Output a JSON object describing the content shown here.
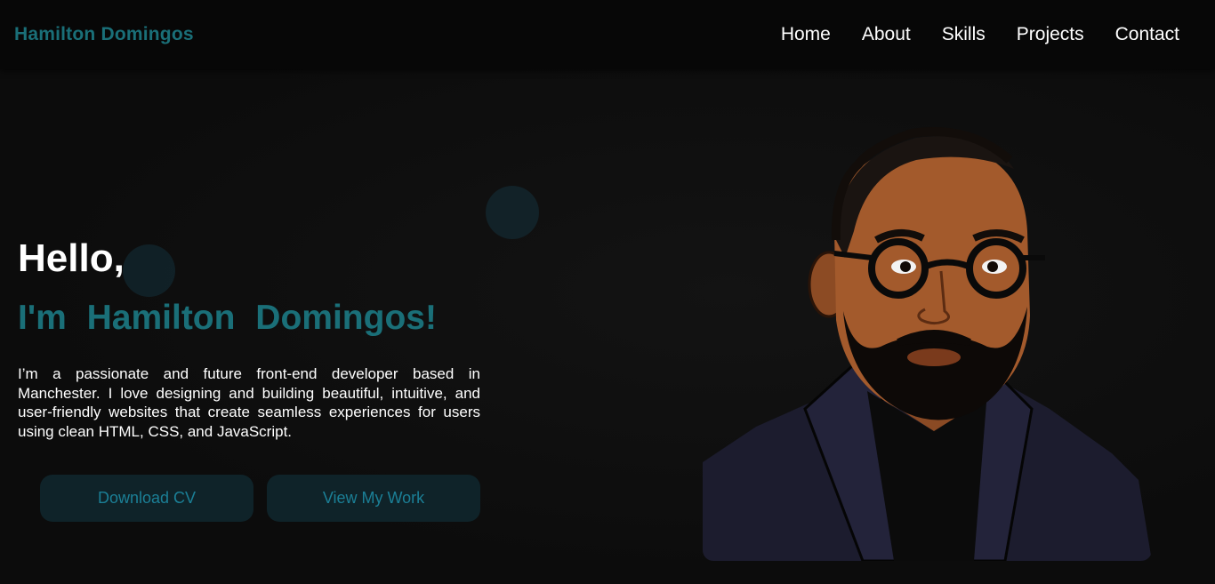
{
  "navbar": {
    "brand": "Hamilton Domingos",
    "links": [
      "Home",
      "About",
      "Skills",
      "Projects",
      "Contact"
    ]
  },
  "hero": {
    "greeting": "Hello,",
    "name_line": "I'm Hamilton Domingos!",
    "intro": "I’m a passionate and future front-end developer based in Manchester. I love designing and building beautiful, intuitive, and user-friendly websites that create seamless experiences for users using clean HTML, CSS, and JavaScript.",
    "buttons": {
      "download_cv": "Download CV",
      "view_work": "View My Work"
    }
  },
  "portrait": {
    "icon": "developer-avatar-illustration"
  },
  "colors": {
    "accent": "#1a6f78",
    "button_text": "#1b7f96",
    "button_bg": "#0f2329",
    "background": "#0d0d0d",
    "nav_bg": "#070707",
    "text": "#ffffff"
  }
}
